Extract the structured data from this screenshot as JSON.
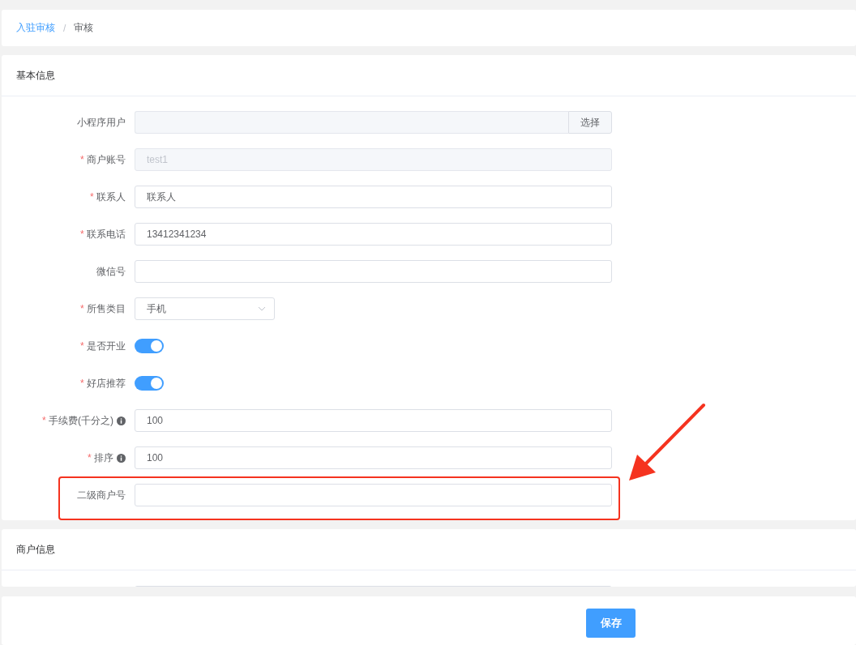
{
  "breadcrumb": [
    {
      "label": "入驻审核",
      "link": true
    },
    {
      "label": "审核",
      "link": false
    }
  ],
  "separator": "/",
  "required_mark": "*",
  "basic_info": {
    "title": "基本信息",
    "fields": [
      {
        "label": "小程序用户",
        "required": false,
        "kind": "picker",
        "button": "选择"
      },
      {
        "label": "商户账号",
        "required": true,
        "kind": "text",
        "disabled": true,
        "value": "test1"
      },
      {
        "label": "联系人",
        "required": true,
        "kind": "text",
        "disabled": false,
        "value": "联系人"
      },
      {
        "label": "联系电话",
        "required": true,
        "kind": "text",
        "disabled": false,
        "value": "13412341234"
      },
      {
        "label": "微信号",
        "required": false,
        "kind": "text"
      },
      {
        "label": "所售类目",
        "required": true,
        "kind": "select",
        "value": "手机"
      },
      {
        "label": "是否开业",
        "required": true,
        "kind": "switch",
        "on": true
      },
      {
        "label": "好店推荐",
        "required": true,
        "kind": "switch",
        "on": true
      },
      {
        "label": "手续费(千分之)",
        "required": true,
        "kind": "text",
        "disabled": false,
        "info": true,
        "value": "100"
      },
      {
        "label": "排序",
        "required": true,
        "kind": "text",
        "disabled": false,
        "info": true,
        "value": "100"
      },
      {
        "label": "二级商户号",
        "required": false,
        "kind": "text",
        "highlighted": true
      }
    ]
  },
  "merchant_info": {
    "title": "商户信息"
  },
  "save_button": "保存"
}
